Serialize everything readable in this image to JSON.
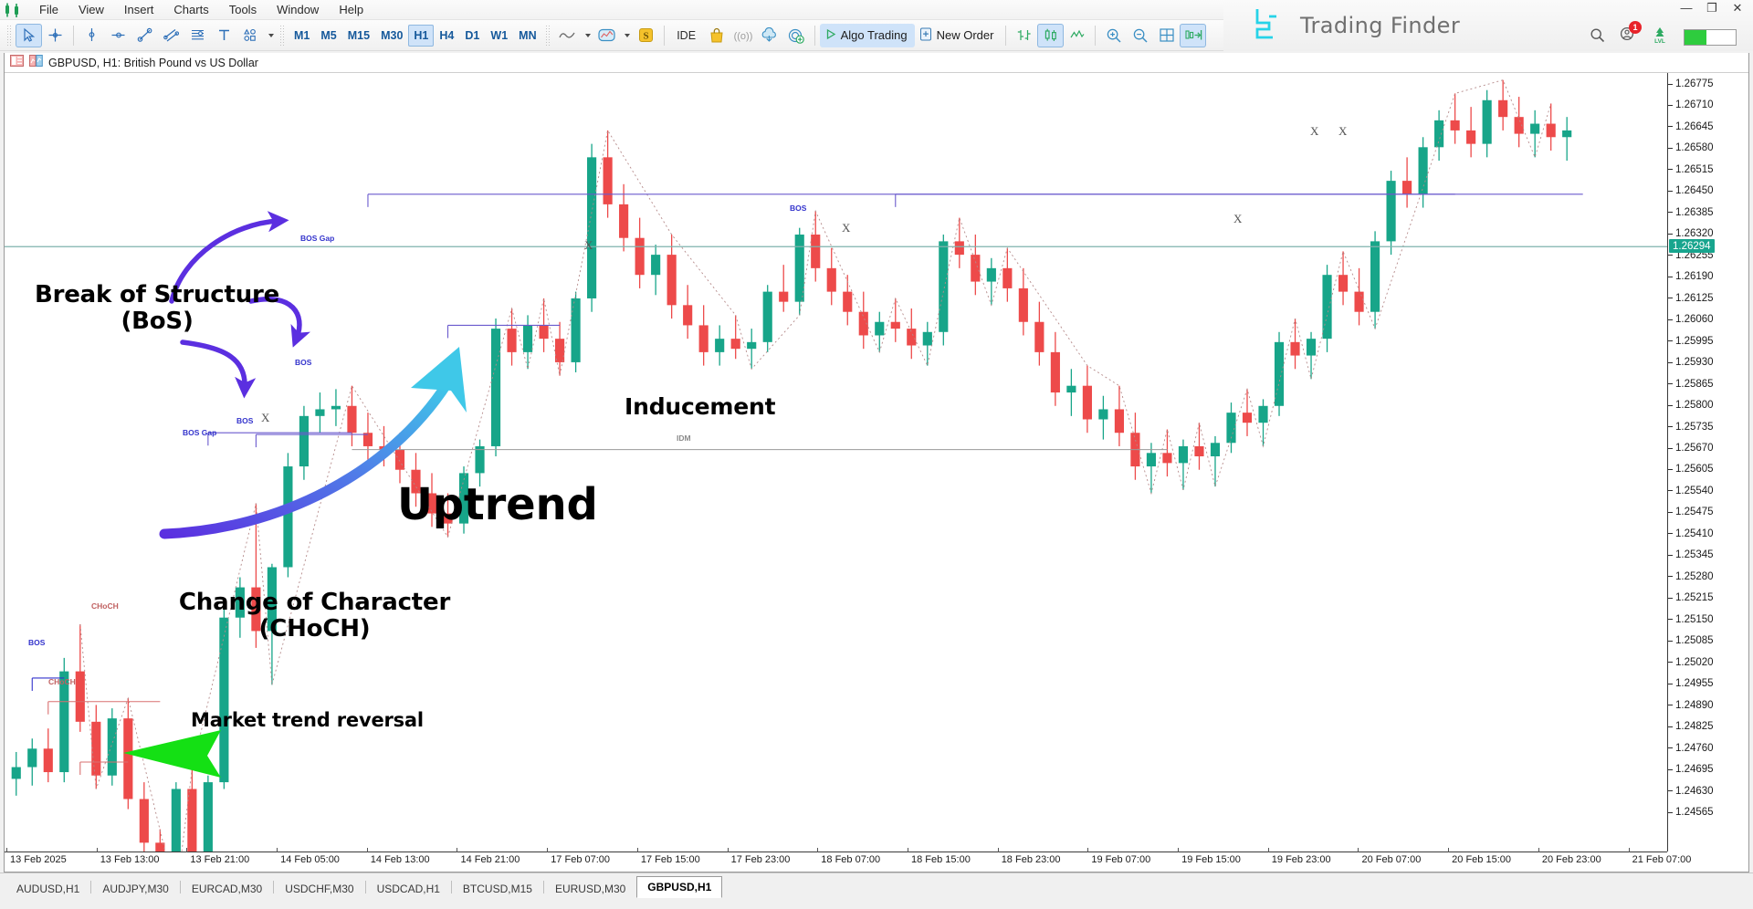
{
  "window": {
    "brand_title": "Trading Finder",
    "minimize": "—",
    "maximize": "❐",
    "close": "✕"
  },
  "menu": {
    "items": [
      "File",
      "View",
      "Insert",
      "Charts",
      "Tools",
      "Window",
      "Help"
    ]
  },
  "toolbar": {
    "cursor_icon": "cursor-arrow-icon",
    "crosshair_icon": "crosshair-icon",
    "vertline_icon": "vertical-line-icon",
    "horzline_icon": "horizontal-line-icon",
    "trendline_icon": "trend-line-icon",
    "channel_icon": "equidistant-channel-icon",
    "fibo_icon": "fibonacci-retracement-icon",
    "text_icon": "text-label-icon",
    "shapes_icon": "shapes-icon",
    "timeframes": [
      "M1",
      "M5",
      "M15",
      "M30",
      "H1",
      "H4",
      "D1",
      "W1",
      "MN"
    ],
    "active_timeframe": "H1",
    "chart_type_icon": "line-chart-icon",
    "template_icon": "templates-icon",
    "strategy_icon": "strategy-tester-icon",
    "ide_label": "IDE",
    "market_icon": "market-bag-icon",
    "signals_icon": "signals-icon",
    "vps_icon": "vps-cloud-icon",
    "copy_icon": "copy-signal-icon",
    "algo_trading_label": "Algo Trading",
    "algo_trading_icon": "play-icon",
    "new_order_label": "New Order",
    "new_order_icon": "new-order-icon",
    "bar_chart_icon": "bar-chart-icon",
    "candles_icon": "candlestick-chart-icon",
    "line_icon": "line-chart-type-icon",
    "zoom_in_icon": "zoom-in-icon",
    "zoom_out_icon": "zoom-out-icon",
    "grid_icon": "grid-icon",
    "autoscroll_icon": "auto-scroll-icon",
    "search_icon": "search-icon",
    "notifications_icon": "notifications-icon",
    "notifications_count": "1",
    "level_icon": "level-icon"
  },
  "chart": {
    "symbol_title": "GBPUSD, H1:  British Pound vs US Dollar",
    "data_window_icon": "data-window-icon",
    "indicators_icon": "indicators-icon",
    "current_price": "1.26294",
    "price_ticks": [
      "1.26775",
      "1.26710",
      "1.26645",
      "1.26580",
      "1.26515",
      "1.26450",
      "1.26385",
      "1.26320",
      "1.26255",
      "1.26190",
      "1.26125",
      "1.26060",
      "1.25995",
      "1.25930",
      "1.25865",
      "1.25800",
      "1.25735",
      "1.25670",
      "1.25605",
      "1.25540",
      "1.25475",
      "1.25410",
      "1.25345",
      "1.25280",
      "1.25215",
      "1.25150",
      "1.25085",
      "1.25020",
      "1.24955",
      "1.24890",
      "1.24825",
      "1.24760",
      "1.24695",
      "1.24630",
      "1.24565"
    ],
    "time_ticks": [
      "13 Feb 2025",
      "13 Feb 13:00",
      "13 Feb 21:00",
      "14 Feb 05:00",
      "14 Feb 13:00",
      "14 Feb 21:00",
      "17 Feb 07:00",
      "17 Feb 15:00",
      "17 Feb 23:00",
      "18 Feb 07:00",
      "18 Feb 15:00",
      "18 Feb 23:00",
      "19 Feb 07:00",
      "19 Feb 15:00",
      "19 Feb 23:00",
      "20 Feb 07:00",
      "20 Feb 15:00",
      "20 Feb 23:00",
      "21 Feb 07:00"
    ],
    "structure_labels": {
      "bos": "BOS",
      "bos_gap": "BOS Gap",
      "choch": "CHoCH",
      "idm": "IDM",
      "swing_marker": "X"
    },
    "colors": {
      "bullish": "#17a589",
      "bearish": "#ed4a4a",
      "bos_line": "#6a5acd",
      "choch_line": "#d97070",
      "idm_line": "#999999",
      "current_price_line": "#7fb3ae"
    }
  },
  "annotations": [
    {
      "id": "break-of-structure",
      "line1": "Break of Structure",
      "line2": "(BoS)"
    },
    {
      "id": "inducement",
      "line1": "Inducement",
      "line2": ""
    },
    {
      "id": "uptrend",
      "line1": "Uptrend",
      "line2": ""
    },
    {
      "id": "change-of-character",
      "line1": "Change of Character",
      "line2": "(CHoCH)"
    },
    {
      "id": "market-trend-reversal",
      "line1": "Market trend reversal",
      "line2": ""
    }
  ],
  "tabs": {
    "items": [
      {
        "label": "AUDUSD,H1",
        "active": false
      },
      {
        "label": "AUDJPY,M30",
        "active": false
      },
      {
        "label": "EURCAD,M30",
        "active": false
      },
      {
        "label": "USDCHF,M30",
        "active": false
      },
      {
        "label": "USDCAD,H1",
        "active": false
      },
      {
        "label": "BTCUSD,M15",
        "active": false
      },
      {
        "label": "EURUSD,M30",
        "active": false
      },
      {
        "label": "GBPUSD,H1",
        "active": true
      }
    ]
  },
  "chart_data": {
    "type": "candlestick",
    "title": "GBPUSD, H1: British Pound vs US Dollar",
    "xlabel": "",
    "ylabel": "",
    "ylim": [
      1.2454,
      1.268
    ],
    "xlim": [
      "13 Feb 2025 00:00",
      "21 Feb 2025 07:00"
    ],
    "grid": false,
    "legend": "none",
    "current_price": 1.26294,
    "candles": [
      {
        "t": 0,
        "o": 1.2471,
        "h": 1.2479,
        "l": 1.2466,
        "c": 1.24745,
        "d": "up"
      },
      {
        "t": 1,
        "o": 1.24745,
        "h": 1.2483,
        "l": 1.2469,
        "c": 1.248,
        "d": "up"
      },
      {
        "t": 2,
        "o": 1.248,
        "h": 1.2486,
        "l": 1.247,
        "c": 1.2473,
        "d": "down"
      },
      {
        "t": 3,
        "o": 1.2473,
        "h": 1.2507,
        "l": 1.247,
        "c": 1.2503,
        "d": "up"
      },
      {
        "t": 4,
        "o": 1.2503,
        "h": 1.2517,
        "l": 1.2485,
        "c": 1.2488,
        "d": "down"
      },
      {
        "t": 5,
        "o": 1.2488,
        "h": 1.2493,
        "l": 1.2468,
        "c": 1.2472,
        "d": "down"
      },
      {
        "t": 6,
        "o": 1.2472,
        "h": 1.2492,
        "l": 1.2469,
        "c": 1.2489,
        "d": "up"
      },
      {
        "t": 7,
        "o": 1.2489,
        "h": 1.2495,
        "l": 1.2462,
        "c": 1.2465,
        "d": "down"
      },
      {
        "t": 8,
        "o": 1.2465,
        "h": 1.247,
        "l": 1.2448,
        "c": 1.2452,
        "d": "down"
      },
      {
        "t": 9,
        "o": 1.2452,
        "h": 1.2456,
        "l": 1.2442,
        "c": 1.2446,
        "d": "down"
      },
      {
        "t": 10,
        "o": 1.2446,
        "h": 1.247,
        "l": 1.2436,
        "c": 1.2468,
        "d": "up"
      },
      {
        "t": 11,
        "o": 1.2468,
        "h": 1.2474,
        "l": 1.244,
        "c": 1.2445,
        "d": "down"
      },
      {
        "t": 12,
        "o": 1.2445,
        "h": 1.2472,
        "l": 1.244,
        "c": 1.247,
        "d": "up"
      },
      {
        "t": 13,
        "o": 1.247,
        "h": 1.2523,
        "l": 1.2468,
        "c": 1.2519,
        "d": "up"
      },
      {
        "t": 14,
        "o": 1.2519,
        "h": 1.2531,
        "l": 1.2513,
        "c": 1.2528,
        "d": "up"
      },
      {
        "t": 15,
        "o": 1.2528,
        "h": 1.2553,
        "l": 1.251,
        "c": 1.2515,
        "d": "down"
      },
      {
        "t": 16,
        "o": 1.2515,
        "h": 1.2535,
        "l": 1.2499,
        "c": 1.2534,
        "d": "up"
      },
      {
        "t": 17,
        "o": 1.2534,
        "h": 1.2568,
        "l": 1.2531,
        "c": 1.2564,
        "d": "up"
      },
      {
        "t": 18,
        "o": 1.2564,
        "h": 1.2582,
        "l": 1.256,
        "c": 1.2579,
        "d": "up"
      },
      {
        "t": 19,
        "o": 1.2579,
        "h": 1.2586,
        "l": 1.2574,
        "c": 1.2581,
        "d": "up"
      },
      {
        "t": 20,
        "o": 1.2581,
        "h": 1.2587,
        "l": 1.2576,
        "c": 1.2582,
        "d": "up"
      },
      {
        "t": 21,
        "o": 1.2582,
        "h": 1.2588,
        "l": 1.257,
        "c": 1.2574,
        "d": "down"
      },
      {
        "t": 22,
        "o": 1.2574,
        "h": 1.258,
        "l": 1.2566,
        "c": 1.257,
        "d": "down"
      },
      {
        "t": 23,
        "o": 1.257,
        "h": 1.2576,
        "l": 1.2564,
        "c": 1.2569,
        "d": "down"
      },
      {
        "t": 24,
        "o": 1.2569,
        "h": 1.2574,
        "l": 1.2559,
        "c": 1.2563,
        "d": "down"
      },
      {
        "t": 25,
        "o": 1.2563,
        "h": 1.2568,
        "l": 1.2552,
        "c": 1.2556,
        "d": "down"
      },
      {
        "t": 26,
        "o": 1.2556,
        "h": 1.2562,
        "l": 1.2546,
        "c": 1.255,
        "d": "down"
      },
      {
        "t": 27,
        "o": 1.255,
        "h": 1.2556,
        "l": 1.2543,
        "c": 1.2547,
        "d": "down"
      },
      {
        "t": 28,
        "o": 1.2547,
        "h": 1.2564,
        "l": 1.2544,
        "c": 1.2562,
        "d": "up"
      },
      {
        "t": 29,
        "o": 1.2562,
        "h": 1.2572,
        "l": 1.2558,
        "c": 1.257,
        "d": "up"
      },
      {
        "t": 30,
        "o": 1.257,
        "h": 1.2608,
        "l": 1.2567,
        "c": 1.2605,
        "d": "up"
      },
      {
        "t": 31,
        "o": 1.2605,
        "h": 1.2611,
        "l": 1.2594,
        "c": 1.2598,
        "d": "down"
      },
      {
        "t": 32,
        "o": 1.2598,
        "h": 1.2609,
        "l": 1.2593,
        "c": 1.2606,
        "d": "up"
      },
      {
        "t": 33,
        "o": 1.2606,
        "h": 1.2614,
        "l": 1.2598,
        "c": 1.2602,
        "d": "down"
      },
      {
        "t": 34,
        "o": 1.2602,
        "h": 1.2607,
        "l": 1.2591,
        "c": 1.2595,
        "d": "down"
      },
      {
        "t": 35,
        "o": 1.2595,
        "h": 1.2616,
        "l": 1.2592,
        "c": 1.2614,
        "d": "up"
      },
      {
        "t": 36,
        "o": 1.2614,
        "h": 1.266,
        "l": 1.261,
        "c": 1.2656,
        "d": "up"
      },
      {
        "t": 37,
        "o": 1.2656,
        "h": 1.2664,
        "l": 1.2638,
        "c": 1.2642,
        "d": "down"
      },
      {
        "t": 38,
        "o": 1.2642,
        "h": 1.2648,
        "l": 1.2628,
        "c": 1.2632,
        "d": "down"
      },
      {
        "t": 39,
        "o": 1.2632,
        "h": 1.2638,
        "l": 1.2617,
        "c": 1.2621,
        "d": "down"
      },
      {
        "t": 40,
        "o": 1.2621,
        "h": 1.263,
        "l": 1.2615,
        "c": 1.2627,
        "d": "up"
      },
      {
        "t": 41,
        "o": 1.2627,
        "h": 1.2633,
        "l": 1.2608,
        "c": 1.2612,
        "d": "down"
      },
      {
        "t": 42,
        "o": 1.2612,
        "h": 1.2618,
        "l": 1.2602,
        "c": 1.2606,
        "d": "down"
      },
      {
        "t": 43,
        "o": 1.2606,
        "h": 1.2612,
        "l": 1.2594,
        "c": 1.2598,
        "d": "down"
      },
      {
        "t": 44,
        "o": 1.2598,
        "h": 1.2606,
        "l": 1.2594,
        "c": 1.2602,
        "d": "up"
      },
      {
        "t": 45,
        "o": 1.2602,
        "h": 1.2609,
        "l": 1.2596,
        "c": 1.2599,
        "d": "down"
      },
      {
        "t": 46,
        "o": 1.2599,
        "h": 1.2605,
        "l": 1.2593,
        "c": 1.2601,
        "d": "up"
      },
      {
        "t": 47,
        "o": 1.2601,
        "h": 1.2618,
        "l": 1.2598,
        "c": 1.2616,
        "d": "up"
      },
      {
        "t": 48,
        "o": 1.2616,
        "h": 1.2624,
        "l": 1.261,
        "c": 1.2613,
        "d": "down"
      },
      {
        "t": 49,
        "o": 1.2613,
        "h": 1.2635,
        "l": 1.2609,
        "c": 1.2633,
        "d": "up"
      },
      {
        "t": 50,
        "o": 1.2633,
        "h": 1.264,
        "l": 1.2619,
        "c": 1.2623,
        "d": "down"
      },
      {
        "t": 51,
        "o": 1.2623,
        "h": 1.2629,
        "l": 1.2612,
        "c": 1.2616,
        "d": "down"
      },
      {
        "t": 52,
        "o": 1.2616,
        "h": 1.2621,
        "l": 1.2606,
        "c": 1.261,
        "d": "down"
      },
      {
        "t": 53,
        "o": 1.261,
        "h": 1.2616,
        "l": 1.2599,
        "c": 1.2603,
        "d": "down"
      },
      {
        "t": 54,
        "o": 1.2603,
        "h": 1.261,
        "l": 1.2598,
        "c": 1.2607,
        "d": "up"
      },
      {
        "t": 55,
        "o": 1.2607,
        "h": 1.2614,
        "l": 1.2601,
        "c": 1.2605,
        "d": "down"
      },
      {
        "t": 56,
        "o": 1.2605,
        "h": 1.2611,
        "l": 1.2596,
        "c": 1.26,
        "d": "down"
      },
      {
        "t": 57,
        "o": 1.26,
        "h": 1.2607,
        "l": 1.2594,
        "c": 1.2604,
        "d": "up"
      },
      {
        "t": 58,
        "o": 1.2604,
        "h": 1.2633,
        "l": 1.26,
        "c": 1.2631,
        "d": "up"
      },
      {
        "t": 59,
        "o": 1.2631,
        "h": 1.2638,
        "l": 1.2623,
        "c": 1.2627,
        "d": "down"
      },
      {
        "t": 60,
        "o": 1.2627,
        "h": 1.2633,
        "l": 1.2615,
        "c": 1.2619,
        "d": "down"
      },
      {
        "t": 61,
        "o": 1.2619,
        "h": 1.2626,
        "l": 1.2612,
        "c": 1.2623,
        "d": "up"
      },
      {
        "t": 62,
        "o": 1.2623,
        "h": 1.2629,
        "l": 1.2613,
        "c": 1.2617,
        "d": "down"
      },
      {
        "t": 63,
        "o": 1.2617,
        "h": 1.2623,
        "l": 1.2603,
        "c": 1.2607,
        "d": "down"
      },
      {
        "t": 64,
        "o": 1.2607,
        "h": 1.2613,
        "l": 1.2594,
        "c": 1.2598,
        "d": "down"
      },
      {
        "t": 65,
        "o": 1.2598,
        "h": 1.2604,
        "l": 1.2582,
        "c": 1.2586,
        "d": "down"
      },
      {
        "t": 66,
        "o": 1.2586,
        "h": 1.2593,
        "l": 1.2579,
        "c": 1.2588,
        "d": "up"
      },
      {
        "t": 67,
        "o": 1.2588,
        "h": 1.2594,
        "l": 1.2574,
        "c": 1.2578,
        "d": "down"
      },
      {
        "t": 68,
        "o": 1.2578,
        "h": 1.2585,
        "l": 1.2572,
        "c": 1.2581,
        "d": "up"
      },
      {
        "t": 69,
        "o": 1.2581,
        "h": 1.2588,
        "l": 1.257,
        "c": 1.2574,
        "d": "down"
      },
      {
        "t": 70,
        "o": 1.2574,
        "h": 1.258,
        "l": 1.256,
        "c": 1.2564,
        "d": "down"
      },
      {
        "t": 71,
        "o": 1.2564,
        "h": 1.2571,
        "l": 1.2556,
        "c": 1.2568,
        "d": "up"
      },
      {
        "t": 72,
        "o": 1.2568,
        "h": 1.2575,
        "l": 1.2561,
        "c": 1.2565,
        "d": "down"
      },
      {
        "t": 73,
        "o": 1.2565,
        "h": 1.2572,
        "l": 1.2557,
        "c": 1.257,
        "d": "up"
      },
      {
        "t": 74,
        "o": 1.257,
        "h": 1.2577,
        "l": 1.2563,
        "c": 1.2567,
        "d": "down"
      },
      {
        "t": 75,
        "o": 1.2567,
        "h": 1.2573,
        "l": 1.2558,
        "c": 1.2571,
        "d": "up"
      },
      {
        "t": 76,
        "o": 1.2571,
        "h": 1.2583,
        "l": 1.2568,
        "c": 1.258,
        "d": "up"
      },
      {
        "t": 77,
        "o": 1.258,
        "h": 1.2587,
        "l": 1.2573,
        "c": 1.2577,
        "d": "down"
      },
      {
        "t": 78,
        "o": 1.2577,
        "h": 1.2584,
        "l": 1.257,
        "c": 1.2582,
        "d": "up"
      },
      {
        "t": 79,
        "o": 1.2582,
        "h": 1.2604,
        "l": 1.2579,
        "c": 1.2601,
        "d": "up"
      },
      {
        "t": 80,
        "o": 1.2601,
        "h": 1.2608,
        "l": 1.2593,
        "c": 1.2597,
        "d": "down"
      },
      {
        "t": 81,
        "o": 1.2597,
        "h": 1.2604,
        "l": 1.259,
        "c": 1.2602,
        "d": "up"
      },
      {
        "t": 82,
        "o": 1.2602,
        "h": 1.2624,
        "l": 1.2598,
        "c": 1.2621,
        "d": "up"
      },
      {
        "t": 83,
        "o": 1.2621,
        "h": 1.2628,
        "l": 1.2612,
        "c": 1.2616,
        "d": "down"
      },
      {
        "t": 84,
        "o": 1.2616,
        "h": 1.2623,
        "l": 1.2606,
        "c": 1.261,
        "d": "down"
      },
      {
        "t": 85,
        "o": 1.261,
        "h": 1.2634,
        "l": 1.2605,
        "c": 1.2631,
        "d": "up"
      },
      {
        "t": 86,
        "o": 1.2631,
        "h": 1.2652,
        "l": 1.2627,
        "c": 1.2649,
        "d": "up"
      },
      {
        "t": 87,
        "o": 1.2649,
        "h": 1.2656,
        "l": 1.2641,
        "c": 1.2645,
        "d": "down"
      },
      {
        "t": 88,
        "o": 1.2645,
        "h": 1.2662,
        "l": 1.2641,
        "c": 1.2659,
        "d": "up"
      },
      {
        "t": 89,
        "o": 1.2659,
        "h": 1.267,
        "l": 1.2655,
        "c": 1.2667,
        "d": "up"
      },
      {
        "t": 90,
        "o": 1.2667,
        "h": 1.2675,
        "l": 1.266,
        "c": 1.2664,
        "d": "down"
      },
      {
        "t": 91,
        "o": 1.2664,
        "h": 1.2671,
        "l": 1.2656,
        "c": 1.266,
        "d": "down"
      },
      {
        "t": 92,
        "o": 1.266,
        "h": 1.2676,
        "l": 1.2656,
        "c": 1.2673,
        "d": "up"
      },
      {
        "t": 93,
        "o": 1.2673,
        "h": 1.2679,
        "l": 1.2664,
        "c": 1.2668,
        "d": "down"
      },
      {
        "t": 94,
        "o": 1.2668,
        "h": 1.2674,
        "l": 1.2659,
        "c": 1.2663,
        "d": "down"
      },
      {
        "t": 95,
        "o": 1.2663,
        "h": 1.267,
        "l": 1.2656,
        "c": 1.2666,
        "d": "up"
      },
      {
        "t": 96,
        "o": 1.2666,
        "h": 1.2672,
        "l": 1.2658,
        "c": 1.2662,
        "d": "down"
      },
      {
        "t": 97,
        "o": 1.2662,
        "h": 1.2668,
        "l": 1.2655,
        "c": 1.2664,
        "d": "up"
      }
    ],
    "structures": [
      {
        "type": "BOS Gap",
        "price": 1.2574,
        "x_start": 12,
        "x_end": 21,
        "color": "#6a5acd"
      },
      {
        "type": "BOS",
        "price": 1.25735,
        "x_start": 15,
        "x_end": 22,
        "color": "#6a5acd"
      },
      {
        "type": "BOS",
        "price": 1.2606,
        "x_start": 27,
        "x_end": 34,
        "color": "#6a5acd"
      },
      {
        "type": "BOS Gap",
        "price": 1.2645,
        "x_start": 22,
        "x_end": 98,
        "color": "#6a5acd"
      },
      {
        "type": "BOS",
        "price": 1.2645,
        "x_start": 55,
        "x_end": 90,
        "color": "#6a5acd"
      },
      {
        "type": "CHoCH",
        "price": 1.2494,
        "x_start": 2,
        "x_end": 9,
        "color": "#d97070"
      },
      {
        "type": "CHoCH",
        "price": 1.2476,
        "x_start": 4,
        "x_end": 7,
        "color": "#d97070"
      },
      {
        "type": "BOS",
        "price": 1.2501,
        "x_start": 1,
        "x_end": 3,
        "color": "#3333cc"
      },
      {
        "type": "IDM",
        "price": 1.2569,
        "x_start": 21,
        "x_end": 72,
        "color": "#999999"
      }
    ]
  }
}
